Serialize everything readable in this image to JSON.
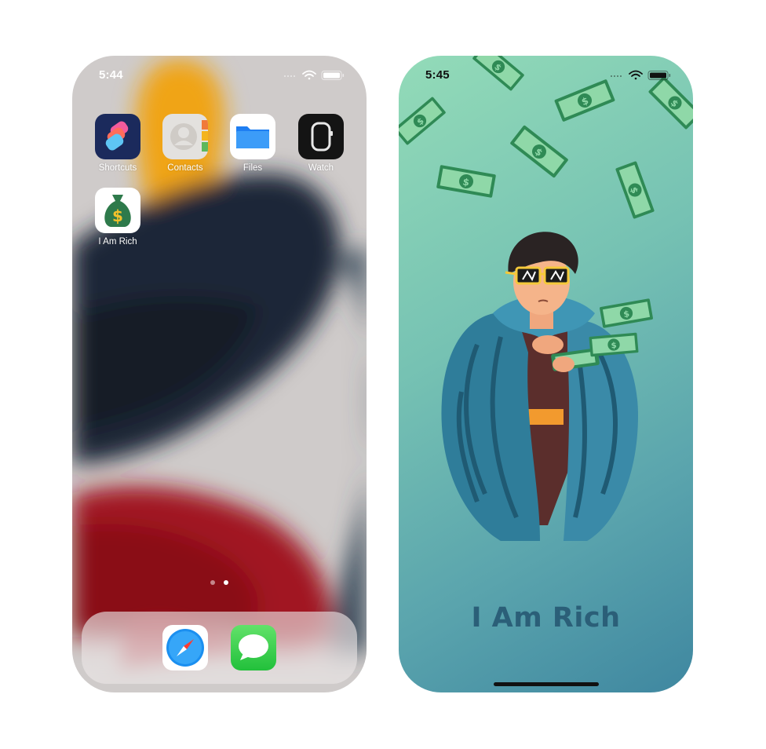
{
  "home_screen": {
    "status_time": "5:44",
    "apps": [
      {
        "name": "Shortcuts",
        "icon": "shortcuts-icon"
      },
      {
        "name": "Contacts",
        "icon": "contacts-icon"
      },
      {
        "name": "Files",
        "icon": "files-folder-icon"
      },
      {
        "name": "Watch",
        "icon": "watch-icon"
      },
      {
        "name": "I Am Rich",
        "icon": "money-bag-icon"
      }
    ],
    "page_count": 2,
    "active_page": 2,
    "dock": [
      {
        "icon": "safari-compass-icon"
      },
      {
        "icon": "messages-bubble-icon"
      }
    ]
  },
  "app_screen": {
    "status_time": "5:45",
    "title": "I Am Rich",
    "illustration": "rich-man-fur-coat-illustration",
    "colors": {
      "gradient_start": "#93dbb8",
      "gradient_end": "#3f87a0",
      "title": "#2b5f78"
    }
  }
}
